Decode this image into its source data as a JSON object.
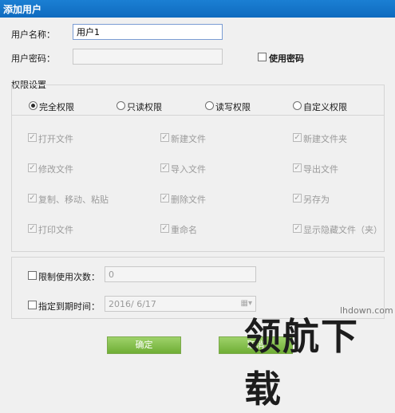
{
  "window": {
    "title": "添加用户"
  },
  "form": {
    "username_label": "用户名称：",
    "username_value": "用户1",
    "password_label": "用户密码：",
    "use_password_label": "使用密码"
  },
  "permissions": {
    "group_label": "权限设置",
    "modes": [
      {
        "label": "完全权限",
        "selected": true
      },
      {
        "label": "只读权限",
        "selected": false
      },
      {
        "label": "读写权限",
        "selected": false
      },
      {
        "label": "自定义权限",
        "selected": false
      }
    ],
    "items": [
      "打开文件",
      "新建文件",
      "新建文件夹",
      "修改文件",
      "导入文件",
      "导出文件",
      "复制、移动、粘贴",
      "删除文件",
      "另存为",
      "打印文件",
      "重命名",
      "显示隐藏文件（夹）"
    ]
  },
  "limits": {
    "use_count_label": "限制使用次数：",
    "use_count_value": "0",
    "expire_label": "指定到期时间：",
    "expire_value": "2016/  6/17"
  },
  "buttons": {
    "ok": "确定",
    "cancel": "取消"
  },
  "watermark": {
    "text": "领航下载",
    "url": "lhdown.com"
  }
}
